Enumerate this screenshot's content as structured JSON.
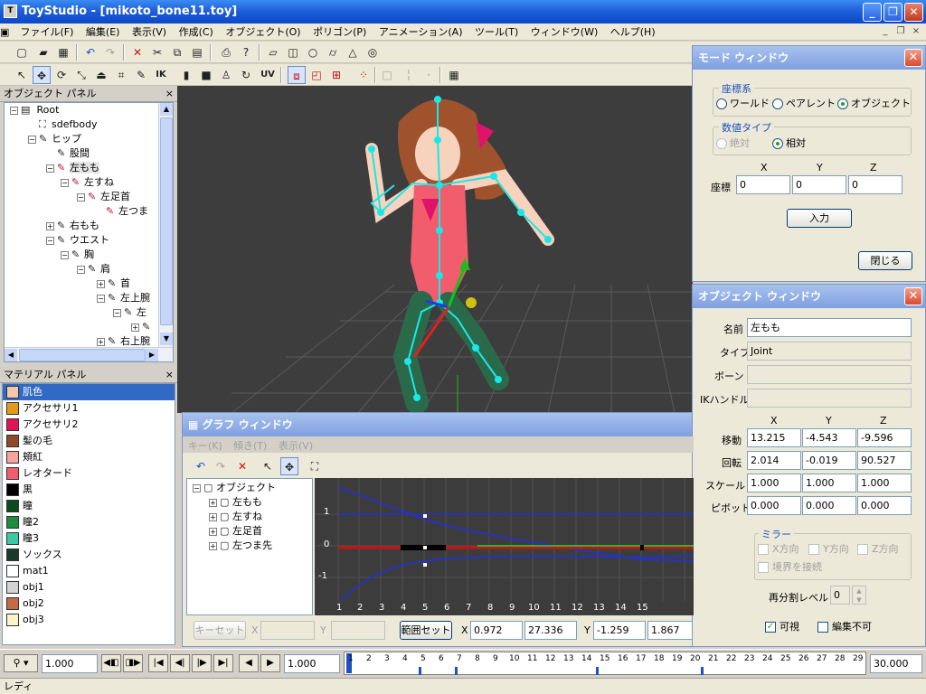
{
  "titlebar": {
    "title": "ToyStudio - [mikoto_bone11.toy]",
    "buttons": [
      "_",
      "❐",
      "✕"
    ]
  },
  "menubar": {
    "items": [
      "ファイル(F)",
      "編集(E)",
      "表示(V)",
      "作成(C)",
      "オブジェクト(O)",
      "ポリゴン(P)",
      "アニメーション(A)",
      "ツール(T)",
      "ウィンドウ(W)",
      "ヘルプ(H)"
    ],
    "mdi_buttons": [
      "_",
      "❐",
      "×"
    ]
  },
  "toolbar_labels": {
    "ik": "IK",
    "uv": "UV"
  },
  "object_panel": {
    "title": "オブジェクト パネル",
    "close": "×",
    "nodes": [
      {
        "label": "Root"
      },
      {
        "label": "sdefbody"
      },
      {
        "label": "ヒップ"
      },
      {
        "label": "股間"
      },
      {
        "label": "左もも"
      },
      {
        "label": "左すね"
      },
      {
        "label": "左足首"
      },
      {
        "label": "左つま"
      },
      {
        "label": "右もも"
      },
      {
        "label": "ウエスト"
      },
      {
        "label": "胸"
      },
      {
        "label": "肩"
      },
      {
        "label": "首"
      },
      {
        "label": "左上腕"
      },
      {
        "label": "左"
      },
      {
        "label": ""
      },
      {
        "label": "右上腕"
      }
    ]
  },
  "material_panel": {
    "title": "マテリアル パネル",
    "close": "×",
    "items": [
      {
        "label": "肌色",
        "color": "#f7c7ad"
      },
      {
        "label": "アクセサリ1",
        "color": "#e39a1b"
      },
      {
        "label": "アクセサリ2",
        "color": "#e21357"
      },
      {
        "label": "髪の毛",
        "color": "#8f4a26"
      },
      {
        "label": "頬紅",
        "color": "#f5a59a"
      },
      {
        "label": "レオタード",
        "color": "#f25d6e"
      },
      {
        "label": "黒",
        "color": "#000000"
      },
      {
        "label": "瞳",
        "color": "#0b4a1e"
      },
      {
        "label": "瞳2",
        "color": "#1e8c3a"
      },
      {
        "label": "瞳3",
        "color": "#3cc7a5"
      },
      {
        "label": "ソックス",
        "color": "#1a3a2a"
      },
      {
        "label": "mat1",
        "color": "#ffffff"
      },
      {
        "label": "obj1",
        "color": "#d4d4d4"
      },
      {
        "label": "obj2",
        "color": "#c46a45"
      },
      {
        "label": "obj3",
        "color": "#fff4c8"
      }
    ]
  },
  "mode_window": {
    "title": "モード ウィンドウ",
    "coord_group": "座標系",
    "coord_options": [
      "ワールド",
      "ペアレント",
      "オブジェクト"
    ],
    "value_group": "数値タイプ",
    "value_options": [
      "絶対",
      "相対"
    ],
    "axis_labels": [
      "X",
      "Y",
      "Z"
    ],
    "row_label": "座標",
    "values": [
      "0",
      "0",
      "0"
    ],
    "input_button": "入力",
    "close_button": "閉じる"
  },
  "object_window": {
    "title": "オブジェクト ウィンドウ",
    "name_label": "名前",
    "name_value": "左もも",
    "type_label": "タイプ",
    "type_value": "Joint",
    "bone_label": "ボーン",
    "bone_value": "",
    "ik_label": "IKハンドル",
    "ik_value": "",
    "axis_labels": [
      "X",
      "Y",
      "Z"
    ],
    "rows": [
      {
        "label": "移動",
        "values": [
          "13.215",
          "-4.543",
          "-9.596"
        ]
      },
      {
        "label": "回転",
        "values": [
          "2.014",
          "-0.019",
          "90.527"
        ]
      },
      {
        "label": "スケール",
        "values": [
          "1.000",
          "1.000",
          "1.000"
        ]
      },
      {
        "label": "ピボット",
        "values": [
          "0.000",
          "0.000",
          "0.000"
        ]
      }
    ],
    "mirror_group": "ミラー",
    "mirror_options": [
      "X方向",
      "Y方向",
      "Z方向"
    ],
    "mirror_connect": "境界を接続",
    "subdiv_label": "再分割レベル",
    "subdiv_value": "0",
    "visible_label": "可視",
    "visible_checked": true,
    "noedit_label": "編集不可",
    "noedit_checked": false
  },
  "graph_window": {
    "title": "グラフ ウィンドウ",
    "menu": [
      "キー(K)",
      "傾き(T)",
      "表示(V)"
    ],
    "tree": [
      "オブジェクト",
      "左もも",
      "左すね",
      "左足首",
      "左つま先"
    ],
    "y_ticks": [
      "1",
      "0",
      "-1"
    ],
    "x_ticks": [
      "1",
      "2",
      "3",
      "4",
      "5",
      "6",
      "7",
      "8",
      "9",
      "10",
      "11",
      "12",
      "13",
      "14",
      "15"
    ],
    "key_set_button": "キーセット",
    "x_label": "X",
    "y_label": "Y",
    "range_button": "範囲セット",
    "range_x_label": "X",
    "range_x_min": "0.972",
    "range_x_max": "27.336",
    "range_y_label": "Y",
    "range_y_min": "-1.259",
    "range_y_max": "1.867"
  },
  "timeline": {
    "speed_value": "1.000",
    "frame_value": "1.000",
    "end_value": "30.000",
    "ticks": [
      "1",
      "2",
      "3",
      "4",
      "5",
      "6",
      "7",
      "8",
      "9",
      "10",
      "11",
      "12",
      "13",
      "14",
      "15",
      "16",
      "17",
      "18",
      "19",
      "20",
      "21",
      "22",
      "23",
      "24",
      "25",
      "26",
      "27",
      "28",
      "29"
    ]
  },
  "status": {
    "text": "レディ"
  }
}
